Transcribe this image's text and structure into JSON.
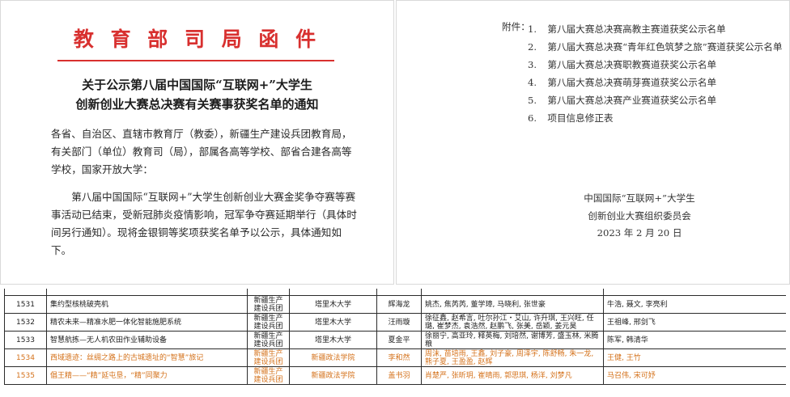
{
  "letter": {
    "letterhead": "教 育 部 司 局 函 件",
    "title_line1": "关于公示第八届中国国际“互联网+”大学生",
    "title_line2": "创新创业大赛总决赛有关赛事获奖名单的通知",
    "salutation": "各省、自治区、直辖市教育厅（教委），新疆生产建设兵团教育局，有关部门（单位）教育司（局），部属各高等学校、部省合建各高等学校，国家开放大学：",
    "paragraph": "第八届中国国际“互联网+”大学生创新创业大赛金奖争夺赛等赛事活动已结束，受新冠肺炎疫情影响，冠军争夺赛延期举行（具体时间另行通知）。现将金银铜等奖项获奖名单予以公示，具体通知如下。"
  },
  "attachments": {
    "label": "附件：",
    "items": [
      {
        "num": "1.",
        "text": "第八届大赛总决赛高教主赛道获奖公示名单"
      },
      {
        "num": "2.",
        "text": "第八届大赛总决赛“青年红色筑梦之旅”赛道获奖公示名单"
      },
      {
        "num": "3.",
        "text": "第八届大赛总决赛职教赛道获奖公示名单"
      },
      {
        "num": "4.",
        "text": "第八届大赛总决赛萌芽赛道获奖公示名单"
      },
      {
        "num": "5.",
        "text": "第八届大赛总决赛产业赛道获奖公示名单"
      },
      {
        "num": "6.",
        "text": "项目信息修正表"
      }
    ],
    "sign_org1": "中国国际“互联网+”大学生",
    "sign_org2": "创新创业大赛组织委员会",
    "sign_date": "2023 年 2 月 20 日"
  },
  "table": {
    "rows": [
      {
        "id": "1531",
        "project": "集约型核桃破壳机",
        "region": "新疆生产建设兵团",
        "school": "塔里木大学",
        "leader": "辉海龙",
        "members": "姚杰, 焦芮芮, 董学璋, 马晓利, 张世豪",
        "advisors": "牛浩, 聂文, 李亮利",
        "highlight": false
      },
      {
        "id": "1532",
        "project": "精农未来—精准水肥一体化智能施肥系统",
        "region": "新疆生产建设兵团",
        "school": "塔里木大学",
        "leader": "汪雨璇",
        "members": "徐征鑫, 赵希言, 吐尔孙江・艾山, 许升琪, 王兴旺, 任璐, 崔梦杰, 袁浩然, 赵鹏飞, 张美, 岳颖, 姜元昊",
        "advisors": "王祖峰, 邢剑飞",
        "highlight": false
      },
      {
        "id": "1533",
        "project": "智慧航拣—无人机农田作业辅助设备",
        "region": "新疆生产建设兵团",
        "school": "塔里木大学",
        "leader": "夏金平",
        "members": "徐丽宁, 高亚玲, 释英梅, 刘培然, 谢博芳, 盛玉林, 米腾粮",
        "advisors": "陈军, 韩清华",
        "highlight": false
      },
      {
        "id": "1534",
        "project": "西域遗迹：丝绸之路上的古城遗址的“智慧”旅记",
        "region": "新疆生产建设兵团",
        "school": "新疆政法学院",
        "leader": "李和然",
        "members": "周沫, 苗培雨, 王鑫, 刘子豪, 周泽宇, 陈舒畅, 朱一龙, 熊子夏, 王盈盈, 赵辉",
        "advisors": "王健, 王竹",
        "highlight": true
      },
      {
        "id": "1535",
        "project": "倡王精——“精”延屯垦，“精”同聚力",
        "region": "新疆生产建设兵团",
        "school": "新疆政法学院",
        "leader": "盖书羽",
        "members": "肖楚严, 张昕玥, 崔晴雨, 郭思琪, 杨洋, 刘梦凡",
        "advisors": "马召伟, 宋可妤",
        "highlight": true
      }
    ]
  }
}
